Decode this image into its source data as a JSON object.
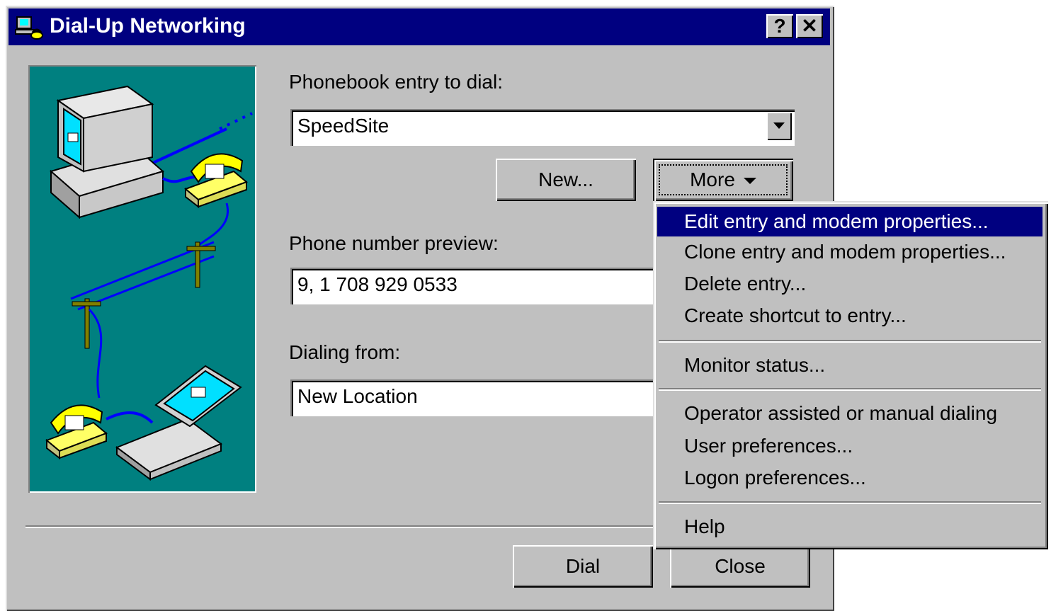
{
  "window": {
    "title": "Dial-Up Networking",
    "help_button": "?",
    "close_button": "✕"
  },
  "form": {
    "phonebook_label": "Phonebook entry to dial:",
    "phonebook_value": "SpeedSite",
    "phone_preview_label": "Phone number preview:",
    "phone_preview_value": "9, 1 708 929 0533",
    "dialing_from_label": "Dialing from:",
    "dialing_from_value": "New Location"
  },
  "buttons": {
    "new": "New...",
    "more": "More",
    "dial": "Dial",
    "close": "Close"
  },
  "more_menu": {
    "items": [
      {
        "label": "Edit entry and modem properties..."
      },
      {
        "label": "Clone entry and modem properties..."
      },
      {
        "label": "Delete entry..."
      },
      {
        "label": "Create shortcut to entry..."
      },
      {
        "label": "Monitor status..."
      },
      {
        "label": "Operator assisted or manual dialing"
      },
      {
        "label": "User preferences..."
      },
      {
        "label": "Logon preferences..."
      },
      {
        "label": "Help"
      }
    ],
    "selected_index": 0
  },
  "colors": {
    "titlebar": "#000080",
    "illustration_bg": "#008080",
    "face": "#c0c0c0",
    "highlight": "#000080"
  }
}
